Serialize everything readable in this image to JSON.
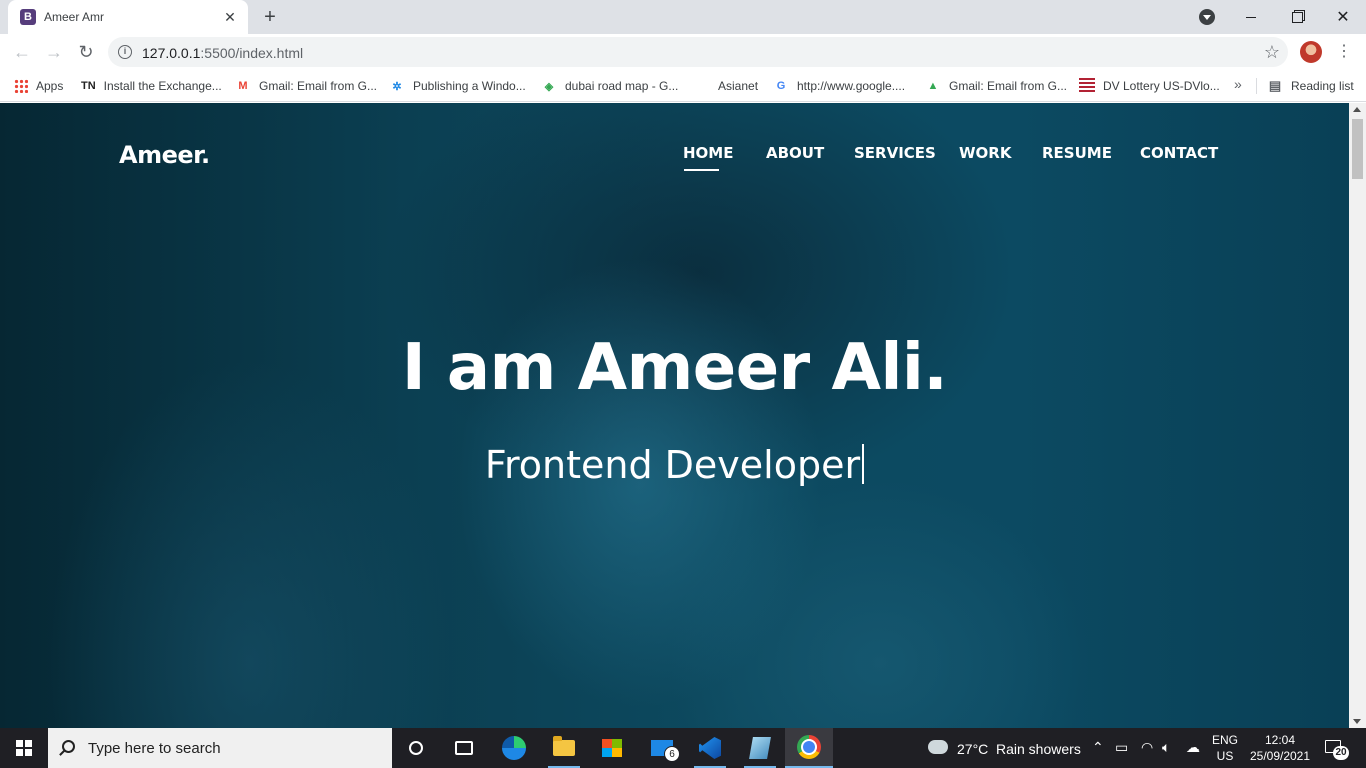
{
  "browser": {
    "tab_favicon": "B",
    "tab_title": "Ameer Amr",
    "url_host": "127.0.0.1",
    "url_path": ":5500/index.html",
    "bookmarks": [
      {
        "label": "Apps",
        "icon": "apps-grid-icon"
      },
      {
        "label": "Install the Exchange...",
        "icon": "TN"
      },
      {
        "label": "Gmail: Email from G...",
        "icon": "gmail-icon"
      },
      {
        "label": "Publishing a Windo...",
        "icon": "publishing-icon"
      },
      {
        "label": "dubai road map - G...",
        "icon": "maps-icon"
      },
      {
        "label": "Asianet",
        "icon": ""
      },
      {
        "label": "http://www.google....",
        "icon": "google-icon"
      },
      {
        "label": "Gmail: Email from G...",
        "icon": "google-drive-icon"
      },
      {
        "label": "DV Lottery US-DVlo...",
        "icon": "us-flag-icon"
      }
    ],
    "reading_list": "Reading list"
  },
  "page": {
    "brand": "Ameer.",
    "nav": [
      "HOME",
      "ABOUT",
      "SERVICES",
      "WORK",
      "RESUME",
      "CONTACT"
    ],
    "active_nav": "HOME",
    "hero_title": "I am Ameer Ali.",
    "hero_subtitle": "Frontend Developer"
  },
  "taskbar": {
    "search_placeholder": "Type here to search",
    "mail_badge": "6",
    "weather_temp": "27°C",
    "weather_condition": "Rain showers",
    "lang_line1": "ENG",
    "lang_line2": "US",
    "time": "12:04",
    "date": "25/09/2021",
    "notification_count": "20"
  },
  "colors": {
    "hero_overlay": "#0b4558",
    "taskbar": "#1f1f24",
    "accent": "#76b9ed"
  }
}
